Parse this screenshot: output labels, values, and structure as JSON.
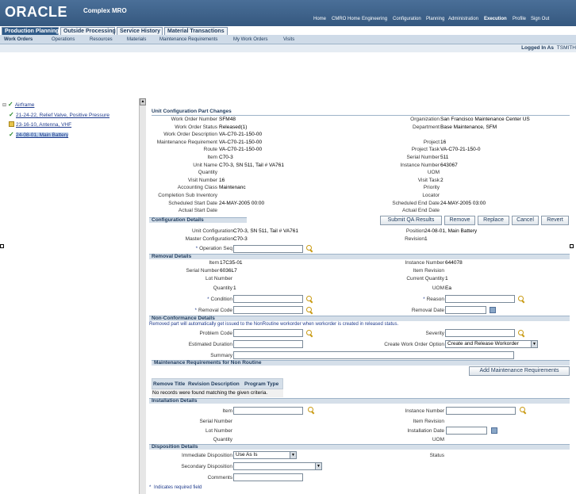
{
  "header": {
    "logo": "ORACLE",
    "app_name": "Complex MRO",
    "global_links": [
      "Home",
      "CMRO Home",
      "Engineering",
      "Configuration",
      "Planning",
      "Administration",
      "Execution",
      "Profile",
      "Sign Out"
    ],
    "active_global": "Execution"
  },
  "tabs": [
    "Production Planning",
    "Outside Processing",
    "Service History",
    "Material Transactions"
  ],
  "active_tab": "Production Planning",
  "subtabs": [
    "Work Orders",
    "Operations",
    "Resources",
    "Materials",
    "Maintenance Requirements",
    "My Work Orders",
    "Visits"
  ],
  "active_subtab": "Work Orders",
  "logged_in": {
    "label": "Logged In As",
    "user": "TSMITH"
  },
  "tree": {
    "root": "Airframe",
    "children": [
      "21-24-22, Relief Valve, Positive Pressure",
      "23-16-10, Antenna, VHF",
      "24-08-01, Main Battery"
    ]
  },
  "unit_config": {
    "title": "Unit Configuration Part Changes",
    "left": [
      {
        "label": "Work Order Number",
        "value": "SFM48"
      },
      {
        "label": "Work Order Status",
        "value": "Released(1)"
      },
      {
        "label": "Work Order Description",
        "value": "VA-C70-21-150-00"
      },
      {
        "label": "Maintenance Requirement",
        "value": "VA-C70-21-150-00"
      },
      {
        "label": "Route",
        "value": "VA-C70-21-150-00"
      },
      {
        "label": "Item",
        "value": "C70-3"
      },
      {
        "label": "Unit Name",
        "value": "C70-3, SN 511, Tail # VA761"
      },
      {
        "label": "Quantity",
        "value": ""
      },
      {
        "label": "Visit Number",
        "value": "16"
      },
      {
        "label": "Accounting Class",
        "value": "Maintenanc"
      },
      {
        "label": "Completion Sub Inventory",
        "value": ""
      },
      {
        "label": "Scheduled Start Date",
        "value": "24-MAY-2005 00:00"
      },
      {
        "label": "Actual Start Date",
        "value": ""
      }
    ],
    "right": [
      {
        "label": "Organization",
        "value": "San Francisco Maintenance Center US"
      },
      {
        "label": "Department",
        "value": "Base Maintenance, SFM"
      },
      {
        "label": "",
        "value": ""
      },
      {
        "label": "Project",
        "value": "16"
      },
      {
        "label": "Project Task",
        "value": "VA-C70-21-150-0"
      },
      {
        "label": "Serial Number",
        "value": "511"
      },
      {
        "label": "Instance Number",
        "value": "643067"
      },
      {
        "label": "UOM",
        "value": ""
      },
      {
        "label": "Visit Task",
        "value": "2"
      },
      {
        "label": "Priority",
        "value": ""
      },
      {
        "label": "Locator",
        "value": ""
      },
      {
        "label": "Scheduled End Date",
        "value": "24-MAY-2005 03:00"
      },
      {
        "label": "Actual End Date",
        "value": ""
      }
    ]
  },
  "config_details": {
    "title": "Configuration Details",
    "buttons": [
      "Submit QA Results",
      "Remove",
      "Replace",
      "Cancel",
      "Revert"
    ],
    "unit_configuration_label": "Unit Configuration",
    "unit_configuration": "C70-3, SN 511, Tail # VA761",
    "master_configuration_label": "Master Configuration",
    "master_configuration": "C70-3",
    "operation_seq_label": "Operation Seq",
    "position_label": "Position",
    "position": "24-08-01, Main Battery",
    "revision_label": "Revision",
    "revision": "1"
  },
  "removal": {
    "title": "Removal Details",
    "item_label": "Item",
    "item": "17C35-01",
    "serial_label": "Serial Number",
    "serial": "6036L7",
    "lot_label": "Lot Number",
    "lot": "",
    "qty_label": "Quantity",
    "qty": "1",
    "condition_label": "Condition",
    "removal_code_label": "Removal Code",
    "instance_label": "Instance Number",
    "instance": "644078",
    "item_revision_label": "Item Revision",
    "item_revision": "",
    "current_qty_label": "Current Quantity",
    "current_qty": "1",
    "uom_label": "UOM",
    "uom": "Ea",
    "reason_label": "Reason",
    "removal_date_label": "Removal Date"
  },
  "non_conformance": {
    "title": "Non-Conformance Details",
    "note": "Removed part will automatically get issued to the NonRoutine workorder when workorder is created in released status.",
    "problem_code_label": "Problem Code",
    "estimated_duration_label": "Estimated Duration",
    "summary_label": "Summary",
    "severity_label": "Severity",
    "create_wo_label": "Create Work Order Option",
    "create_wo_value": "Create and Release Workorder"
  },
  "maint_req": {
    "title": "Maintenance Requirements for Non Routine",
    "add_button": "Add Maintenance Requirements",
    "columns": [
      "Remove",
      "Title",
      "Revision",
      "Description",
      "Program Type"
    ],
    "empty": "No records were found matching the given criteria."
  },
  "installation": {
    "title": "Installation Details",
    "item_label": "Item",
    "serial_label": "Serial Number",
    "lot_label": "Lot Number",
    "qty_label": "Quantity",
    "instance_label": "Instance Number",
    "item_revision_label": "Item Revision",
    "install_date_label": "Installation Date",
    "uom_label": "UOM"
  },
  "disposition": {
    "title": "Disposition Details",
    "immediate_label": "Immediate Disposition",
    "immediate_value": "Use As Is",
    "secondary_label": "Secondary Disposition",
    "comments_label": "Comments",
    "status_label": "Status"
  },
  "footer": {
    "required_note": "Indicates required field",
    "required_symbol": "*"
  }
}
